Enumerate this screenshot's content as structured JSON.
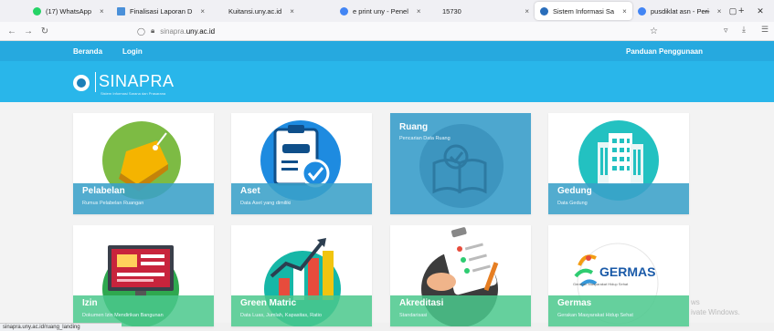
{
  "browser": {
    "tabs": [
      {
        "label": "(17) WhatsApp",
        "color": "#25d366"
      },
      {
        "label": "Finalisasi Laporan D",
        "color": "#4a90d9"
      },
      {
        "label": "Kuitansi.uny.ac.id",
        "color": ""
      },
      {
        "label": "e print uny - Penel",
        "color": "#4285f4"
      },
      {
        "label": "15730",
        "color": ""
      },
      {
        "label": "Sistem Informasi Sa",
        "color": "#2a6ebb"
      },
      {
        "label": "pusdiklat asn - Peri",
        "color": "#4285f4"
      }
    ],
    "tab_close": "×",
    "new_tab": "+",
    "window_controls": [
      "—",
      "▢",
      "✕"
    ],
    "url_prefix": "sinapra.",
    "url_domain": "uny.ac.id",
    "status_url": "sinapra.uny.ac.id/ruang_landing"
  },
  "site": {
    "nav": {
      "home": "Beranda",
      "login": "Login",
      "guide": "Panduan Penggunaan"
    },
    "logo_title": "SINAPRA",
    "logo_subtitle": "Sistem Informasi Sarana dan Prasarana",
    "colors": {
      "primary": "#26a9df",
      "hero": "#29b6ea",
      "band_blue": "#3aa0c8",
      "band_green": "#4ac88c"
    }
  },
  "cards": [
    {
      "title": "Pelabelan",
      "subtitle": "Rumus Pelabelan Ruangan",
      "icon": "tag-icon"
    },
    {
      "title": "Aset",
      "subtitle": "Data Aset yang dimiliki",
      "icon": "clipboard-car-icon"
    },
    {
      "title": "Ruang",
      "subtitle": "Pencarian Data Ruang",
      "icon": "book-icon"
    },
    {
      "title": "Gedung",
      "subtitle": "Data Gedung",
      "icon": "building-icon"
    },
    {
      "title": "Izin",
      "subtitle": "Dokumen Izin Mendirikan Bangunan",
      "icon": "monitor-icon"
    },
    {
      "title": "Green Matric",
      "subtitle": "Data Luas, Jumlah, Kapasitas, Ratio",
      "icon": "bar-chart-icon"
    },
    {
      "title": "Akreditasi",
      "subtitle": "Standarisasi",
      "icon": "checklist-icon"
    },
    {
      "title": "Germas",
      "subtitle": "Gerakan Masyarakat Hidup Sehat",
      "icon": "germas-logo-icon"
    }
  ],
  "germas_logo": {
    "text": "GERMAS",
    "tagline": "Gerakan Masyarakat Hidup Sehat"
  },
  "watermark": {
    "line1": "ws",
    "line2": "ivate Windows."
  }
}
